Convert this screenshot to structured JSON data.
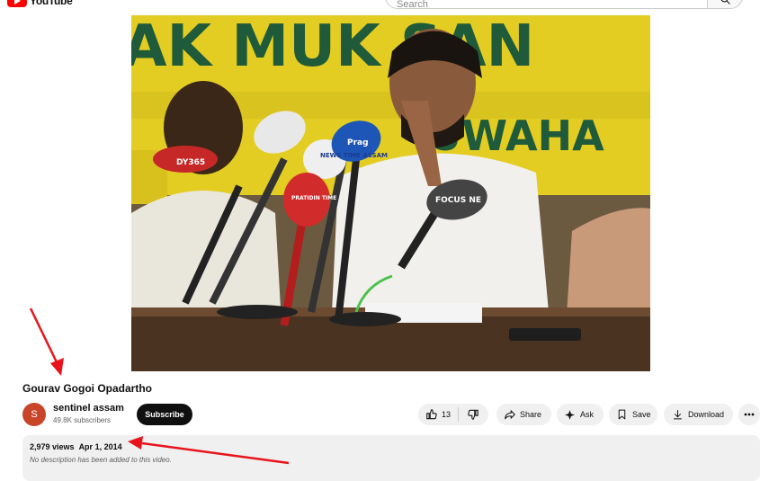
{
  "header": {
    "logo_text": "YouTube",
    "search_placeholder": "Search"
  },
  "video": {
    "title": "Gourav Gogoi Opadartho",
    "banner_text_top": "AK MUK SAN",
    "banner_text_bottom": "UWAHA",
    "mic_labels": [
      "DY365",
      "NEWS TIME ASSAM",
      "Prag",
      "FOCUS NE",
      "PRATIDIN TIME"
    ]
  },
  "channel": {
    "avatar_letter": "S",
    "name": "sentinel assam",
    "subscribers": "49.8K subscribers",
    "subscribe_label": "Subscribe"
  },
  "actions": {
    "like_count": "13",
    "share_label": "Share",
    "ask_label": "Ask",
    "save_label": "Save",
    "download_label": "Download"
  },
  "description": {
    "views": "2,979 views",
    "date": "Apr 1, 2014",
    "text": "No description has been added to this video."
  },
  "colors": {
    "annotation_arrow": "#e8141c",
    "subscribe_bg": "#0f0f0f",
    "avatar_bg": "#c8452a",
    "pill_bg": "#f0f0f0",
    "banner_yellow": "#e8d21c"
  }
}
